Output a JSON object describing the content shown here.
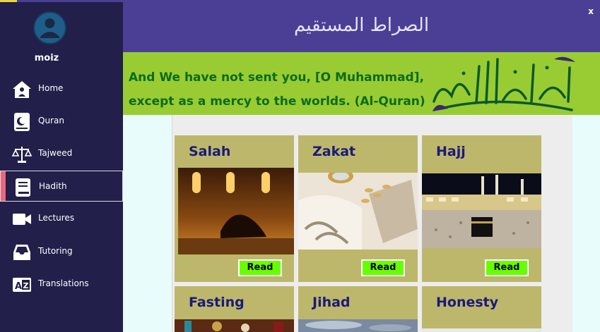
{
  "window": {
    "close_label": "x"
  },
  "user": {
    "name": "moiz"
  },
  "sidebar": {
    "items": [
      {
        "label": "Home",
        "icon": "home-icon"
      },
      {
        "label": "Quran",
        "icon": "quran-book-icon"
      },
      {
        "label": "Tajweed",
        "icon": "scales-icon"
      },
      {
        "label": "Hadith",
        "icon": "book-icon",
        "active": true
      },
      {
        "label": "Lectures",
        "icon": "video-camera-icon"
      },
      {
        "label": "Tutoring",
        "icon": "inbox-tray-icon"
      },
      {
        "label": "Translations",
        "icon": "translate-icon"
      }
    ]
  },
  "header": {
    "title": "الصراط المستقيم"
  },
  "banner": {
    "quote_line1": "And We have not sent you, [O Muhammad],",
    "quote_line2": "except as a mercy to the worlds. (Al-Quran)"
  },
  "cards": [
    {
      "title": "Salah",
      "button": "Read",
      "image": "prayer-photo"
    },
    {
      "title": "Zakat",
      "button": "Read",
      "image": "coin-charity-photo"
    },
    {
      "title": "Hajj",
      "button": "Read",
      "image": "kaaba-photo"
    },
    {
      "title": "Fasting",
      "image": "iftar-photo"
    },
    {
      "title": "Jihad",
      "image": "sky-photo"
    },
    {
      "title": "Honesty",
      "image": ""
    }
  ],
  "colors": {
    "sidebar": "#221f4a",
    "header": "#4a3f94",
    "banner": "#99cc33",
    "card": "#bdb76b",
    "read_button": "#66ff00",
    "active_marker": "#e86a7a"
  }
}
